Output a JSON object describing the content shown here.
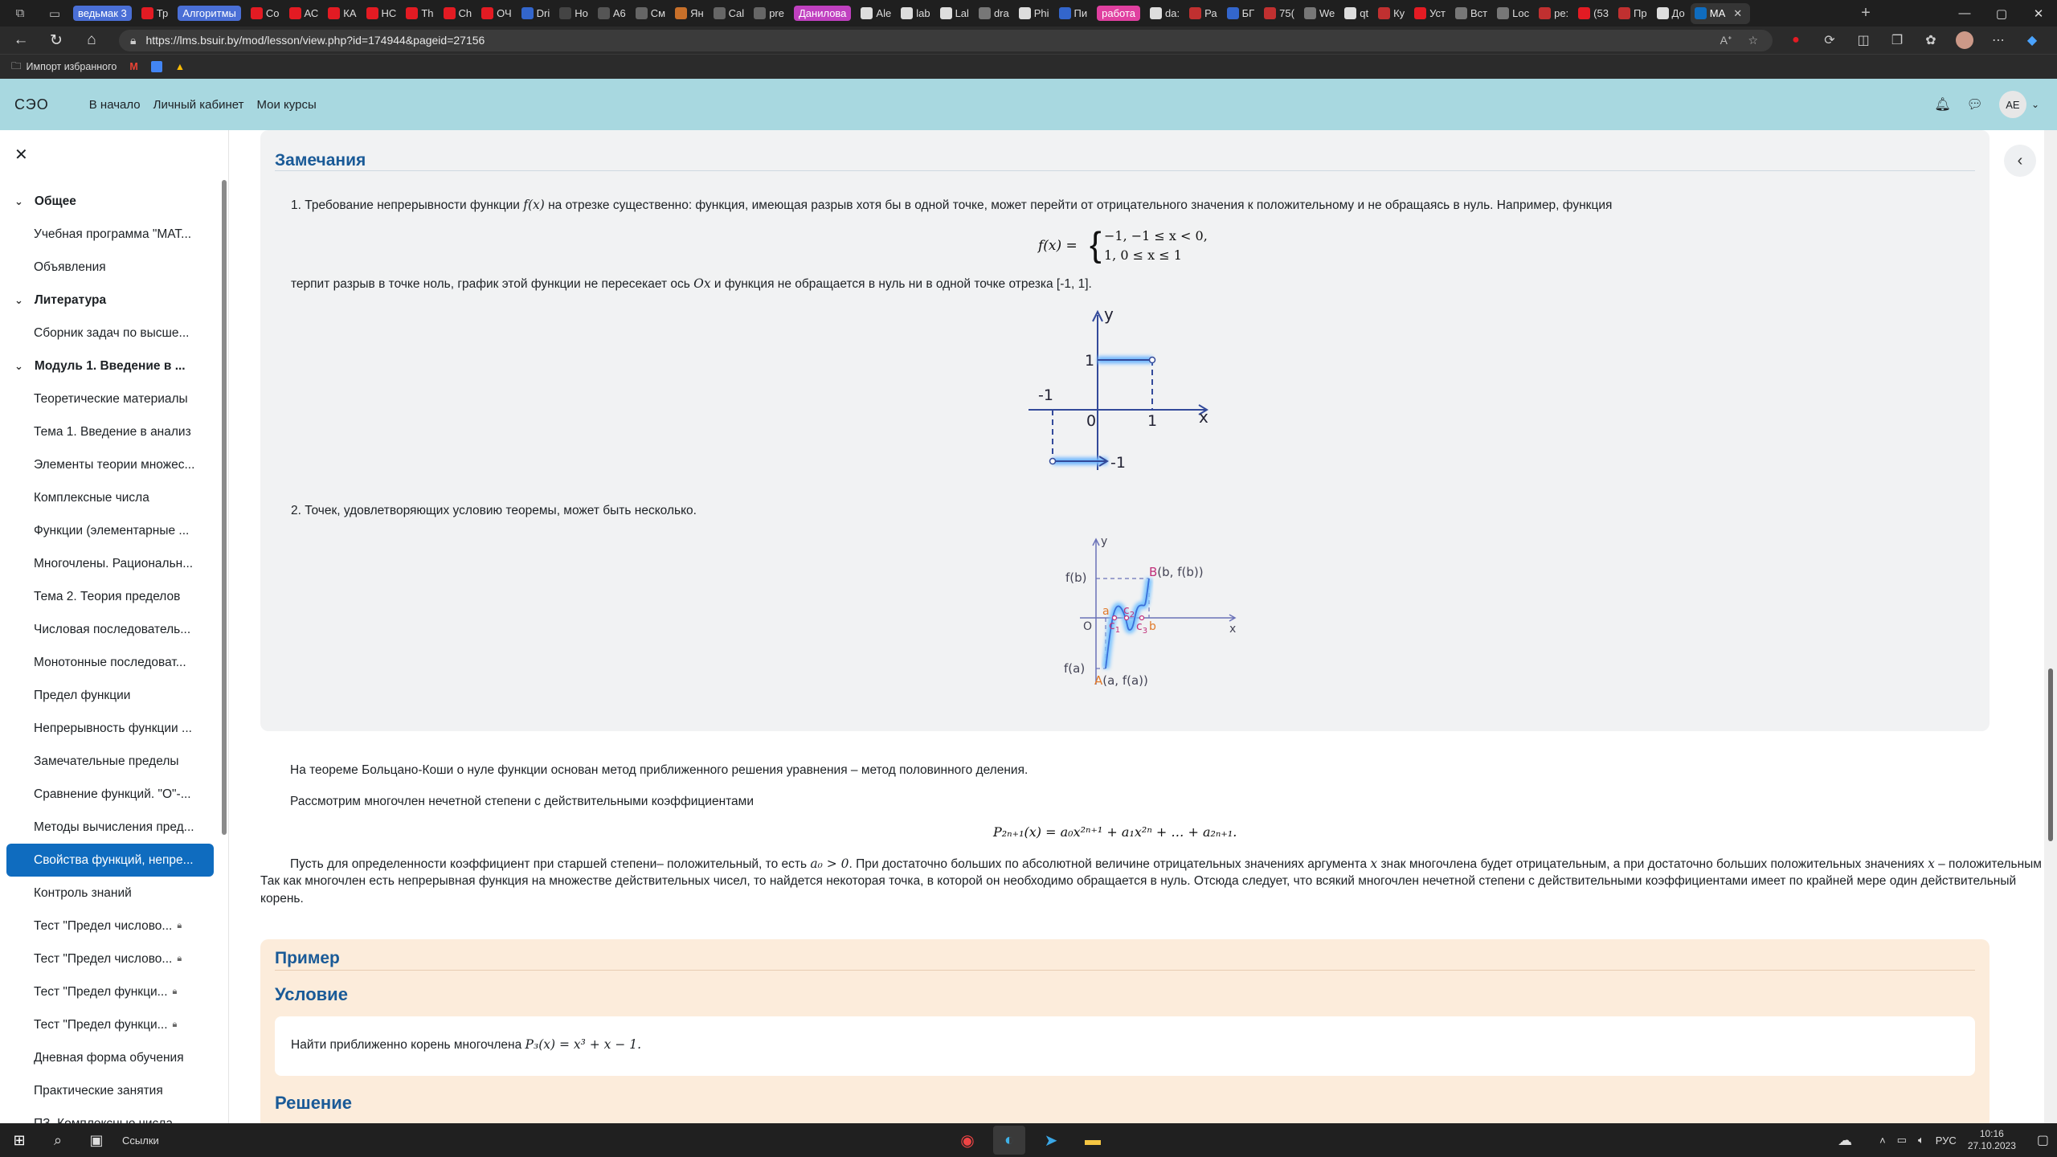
{
  "browser": {
    "tabs": [
      {
        "label": "ведьмак 3",
        "pill": true,
        "favcolor": "#4a6fd6"
      },
      {
        "label": "Тр",
        "favcolor": "#e31b23"
      },
      {
        "label": "Алгоритмы",
        "pill": true,
        "favcolor": "#4a6fd6"
      },
      {
        "label": "Co",
        "favcolor": "#e31b23"
      },
      {
        "label": "АС",
        "favcolor": "#e31b23"
      },
      {
        "label": "КА",
        "favcolor": "#e31b23"
      },
      {
        "label": "НС",
        "favcolor": "#e31b23"
      },
      {
        "label": "Th",
        "favcolor": "#e31b23"
      },
      {
        "label": "Ch",
        "favcolor": "#e31b23"
      },
      {
        "label": "ОЧ",
        "favcolor": "#e31b23"
      },
      {
        "label": "Dri",
        "favcolor": "#3366cc"
      },
      {
        "label": "Ho",
        "favcolor": "#444"
      },
      {
        "label": "A6",
        "favcolor": "#555"
      },
      {
        "label": "См",
        "favcolor": "#666"
      },
      {
        "label": "Ян",
        "favcolor": "#c8702a"
      },
      {
        "label": "Cal",
        "favcolor": "#666"
      },
      {
        "label": "pre",
        "favcolor": "#666"
      },
      {
        "label": "Данилова",
        "pill": true,
        "favcolor": "#c040c0"
      },
      {
        "label": "Ale",
        "favcolor": "#ddd"
      },
      {
        "label": "lab",
        "favcolor": "#ddd"
      },
      {
        "label": "Lal",
        "favcolor": "#ddd"
      },
      {
        "label": "dra",
        "favcolor": "#777"
      },
      {
        "label": "Phi",
        "favcolor": "#ddd"
      },
      {
        "label": "Пи",
        "favcolor": "#3366cc"
      },
      {
        "label": "работа",
        "pill": true,
        "favcolor": "#e040a0"
      },
      {
        "label": "da:",
        "favcolor": "#ddd"
      },
      {
        "label": "Ра",
        "favcolor": "#c03030"
      },
      {
        "label": "БГ",
        "favcolor": "#3366cc"
      },
      {
        "label": "75(",
        "favcolor": "#c03030"
      },
      {
        "label": "We",
        "favcolor": "#777"
      },
      {
        "label": "qt",
        "favcolor": "#ddd"
      },
      {
        "label": "Ку",
        "favcolor": "#c03030"
      },
      {
        "label": "Уст",
        "favcolor": "#e31b23"
      },
      {
        "label": "Вст",
        "favcolor": "#777"
      },
      {
        "label": "Loc",
        "favcolor": "#777"
      },
      {
        "label": "ре:",
        "favcolor": "#c03030"
      },
      {
        "label": "(53",
        "favcolor": "#e31b23"
      },
      {
        "label": "Пр",
        "favcolor": "#c03030"
      },
      {
        "label": "До",
        "favcolor": "#ddd"
      },
      {
        "label": "МА",
        "active": true,
        "favcolor": "#0f6cbf"
      }
    ],
    "new_tab": "+",
    "url": "https://lms.bsuir.by/mod/lesson/view.php?id=174944&pageid=27156",
    "bookmark_label": "Импорт избранного"
  },
  "navbar": {
    "logo": "СЭО",
    "links": [
      "В начало",
      "Личный кабинет",
      "Мои курсы"
    ],
    "avatar": "AE"
  },
  "sidebar": [
    {
      "type": "section",
      "label": "Общее"
    },
    {
      "type": "item",
      "label": "Учебная программа \"МАТ..."
    },
    {
      "type": "item",
      "label": "Объявления"
    },
    {
      "type": "section",
      "label": "Литература"
    },
    {
      "type": "item",
      "label": "Сборник задач по высше..."
    },
    {
      "type": "section",
      "label": "Модуль 1. Введение в ..."
    },
    {
      "type": "item",
      "label": "Теоретические материалы"
    },
    {
      "type": "item",
      "label": "Тема 1. Введение в анализ"
    },
    {
      "type": "item",
      "label": "Элементы теории множес..."
    },
    {
      "type": "item",
      "label": "Комплексные числа"
    },
    {
      "type": "item",
      "label": "Функции (элементарные ..."
    },
    {
      "type": "item",
      "label": "Многочлены. Рациональн..."
    },
    {
      "type": "item",
      "label": "Тема 2. Теория пределов"
    },
    {
      "type": "item",
      "label": "Числовая последователь..."
    },
    {
      "type": "item",
      "label": "Монотонные последоват..."
    },
    {
      "type": "item",
      "label": "Предел функции"
    },
    {
      "type": "item",
      "label": "Непрерывность функции ..."
    },
    {
      "type": "item",
      "label": "Замечательные пределы"
    },
    {
      "type": "item",
      "label": "Сравнение функций. \"О\"-..."
    },
    {
      "type": "item",
      "label": "Методы вычисления пред..."
    },
    {
      "type": "item",
      "label": "Свойства функций, непре...",
      "current": true
    },
    {
      "type": "item",
      "label": "Контроль знаний"
    },
    {
      "type": "item",
      "label": "Тест \"Предел числово...",
      "locked": true
    },
    {
      "type": "item",
      "label": "Тест \"Предел числово...",
      "locked": true
    },
    {
      "type": "item",
      "label": "Тест \"Предел функци...",
      "locked": true
    },
    {
      "type": "item",
      "label": "Тест \"Предел функци...",
      "locked": true
    },
    {
      "type": "item",
      "label": "Дневная форма обучения"
    },
    {
      "type": "item",
      "label": "Практические занятия"
    },
    {
      "type": "item",
      "label": "ПЗ. Комплексные числа"
    }
  ],
  "content": {
    "notes_heading": "Замечания",
    "note1_a": "1. Требование непрерывности функции",
    "note1_fx": "f(x)",
    "note1_b": "на отрезке существенно: функция, имеющая разрыв хотя бы в одной точке, может перейти от отрицательного значения к положительному и не обращаясь в нуль. Например, функция",
    "piecewise_lhs": "f(x) =",
    "piece1": "−1,   −1 ≤ x < 0,",
    "piece2": "1,   0 ≤ x ≤ 1",
    "note1_c": "терпит разрыв в точке ноль, график этой функции не пересекает ось",
    "note1_ox": "Ox",
    "note1_d": "и функция не обращается в нуль ни в одной точке отрезка [-1, 1].",
    "graph1": {
      "y": "y",
      "x": "x",
      "one_y": "1",
      "neg_one_x": "-1",
      "zero": "0",
      "one_x": "1",
      "neg_one_y": "-1"
    },
    "note2": "2. Точек, удовлетворяющих условию теоремы, может быть несколько.",
    "graph2": {
      "y": "y",
      "x": "x",
      "fb": "f(b)",
      "fa": "f(a)",
      "O": "O",
      "a": "a",
      "b": "b",
      "c1": "c",
      "c1s": "1",
      "c2": "c",
      "c2s": "2",
      "c3": "c",
      "c3s": "3",
      "B": "B",
      "Bcoord": "(b, f(b))",
      "A": "A",
      "Acoord": "(a, f(a))"
    },
    "para1": "На теореме Больцано-Коши о нуле функции основан метод приближенного решения уравнения – метод половинного деления.",
    "para2": "Рассмотрим многочлен нечетной степени с действительными коэффициентами",
    "poly_formula": "P₂ₙ₊₁(x) = a₀x²ⁿ⁺¹ + a₁x²ⁿ + … + a₂ₙ₊₁.",
    "para3_a": "Пусть для определенности коэффициент при старшей степени– положительный, то есть",
    "para3_cond": "a₀ > 0",
    "para3_b": ". При достаточно больших по абсолютной величине отрицательных значениях аргумента",
    "para3_x1": "x",
    "para3_c": "знак многочлена будет отрицательным, а при достаточно больших положительных значениях",
    "para3_x2": "x",
    "para3_d": "– положительным.",
    "para3_line2": "Так как многочлен есть непрерывная функция на множестве действительных чисел, то найдется некоторая точка, в которой он необходимо обращается в нуль. Отсюда следует, что всякий многочлен нечетной степени с действительными коэффициентами имеет по крайней мере один действительный",
    "para3_line3": "корень.",
    "example_heading": "Пример",
    "condition_heading": "Условие",
    "condition_text": "Найти приближенно корень многочлена",
    "condition_formula": "P₃(x) = x³ + x − 1.",
    "solution_heading": "Решение"
  },
  "taskbar": {
    "search_label": "Ссылки",
    "lang": "РУС",
    "time": "10:16",
    "date": "27.10.2023"
  }
}
